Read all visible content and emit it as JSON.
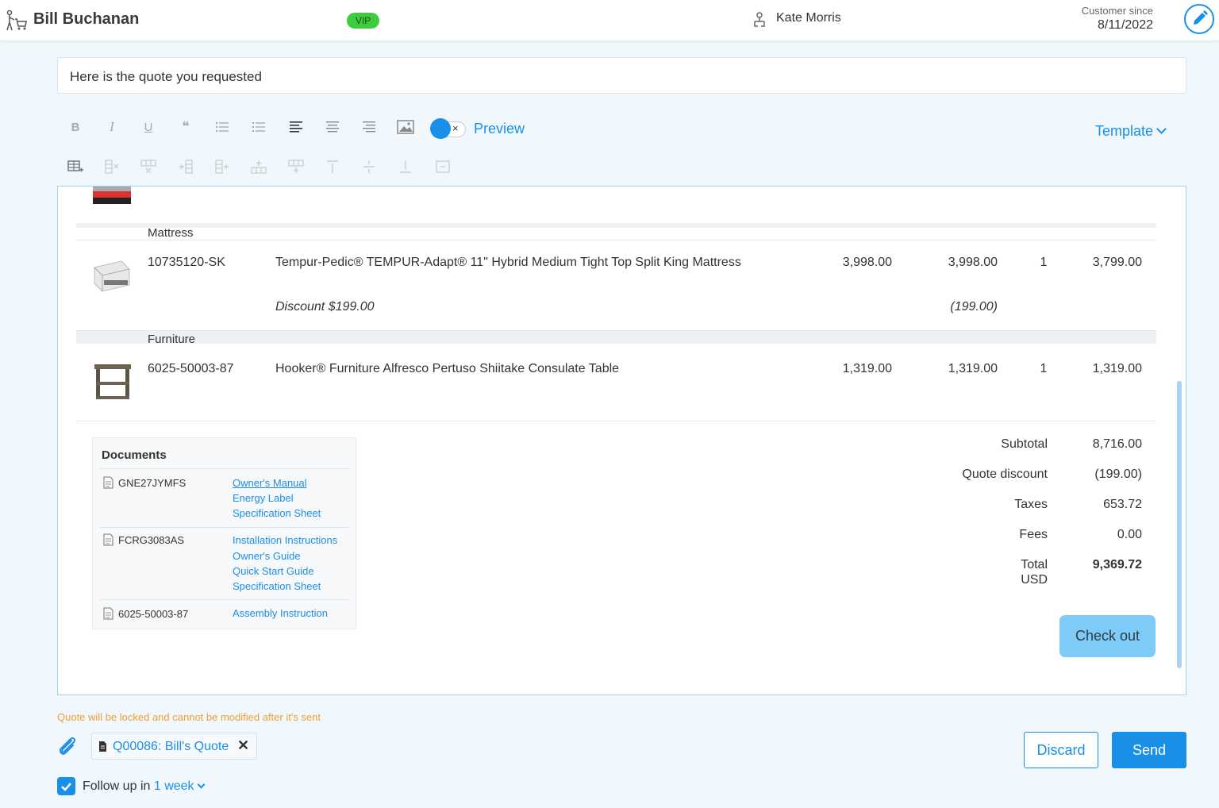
{
  "header": {
    "customer_name": "Bill Buchanan",
    "badge": "VIP",
    "agent_name": "Kate Morris",
    "customer_since_label": "Customer since",
    "customer_since_date": "8/11/2022"
  },
  "subject": "Here is the quote you requested",
  "toolbar": {
    "row1": [
      "bold-icon",
      "italic-icon",
      "underline-icon",
      "blockquote-icon",
      "bullet-list-icon",
      "numbered-list-icon",
      "align-left-icon",
      "align-center-icon",
      "align-right-icon",
      "image-icon"
    ],
    "row2": [
      "insert-table-icon",
      "delete-column-icon",
      "delete-row-icon",
      "insert-column-before-icon",
      "insert-column-after-icon",
      "insert-row-after-icon",
      "insert-row-before-icon",
      "align-top-icon",
      "align-middle-icon",
      "align-bottom-icon",
      "merge-cells-icon"
    ],
    "bold_glyph": "B",
    "italic_glyph": "I",
    "underline_glyph": "U",
    "quote_glyph": "❝",
    "preview_label": "Preview",
    "template_label": "Template",
    "toggle_close": "×"
  },
  "quote": {
    "groups": [
      {
        "category": "Mattress",
        "sku": "10735120-SK",
        "description": "Tempur-Pedic® TEMPUR-Adapt® 11\" Hybrid Medium Tight Top Split King Mattress",
        "list_price": "3,998.00",
        "price": "3,998.00",
        "qty": "1",
        "total": "3,799.00",
        "discount_label": "Discount $199.00",
        "discount_value": "(199.00)"
      },
      {
        "category": "Furniture",
        "sku": "6025-50003-87",
        "description": "Hooker® Furniture Alfresco Pertuso Shiitake Consulate Table",
        "list_price": "1,319.00",
        "price": "1,319.00",
        "qty": "1",
        "total": "1,319.00"
      }
    ],
    "documents": {
      "title": "Documents",
      "items": [
        {
          "id": "GNE27JYMFS",
          "links": [
            "Owner's Manual",
            "Energy Label",
            "Specification Sheet"
          ]
        },
        {
          "id": "FCRG3083AS",
          "links": [
            "Installation Instructions",
            "Owner's Guide",
            "Quick Start Guide",
            "Specification Sheet"
          ]
        },
        {
          "id": "6025-50003-87",
          "links": [
            "Assembly Instruction"
          ]
        }
      ]
    },
    "totals": {
      "subtotal_label": "Subtotal",
      "subtotal": "8,716.00",
      "discount_label": "Quote discount",
      "discount": "(199.00)",
      "taxes_label": "Taxes",
      "taxes": "653.72",
      "fees_label": "Fees",
      "fees": "0.00",
      "total_label": "Total",
      "currency": "USD",
      "total": "9,369.72"
    },
    "checkout_label": "Check out"
  },
  "footer": {
    "warning": "Quote will be locked and cannot be modified after it's sent",
    "attachment": "Q00086: Bill's Quote",
    "attachment_remove": "✕",
    "discard_label": "Discard",
    "send_label": "Send",
    "follow_up_label": "Follow up",
    "follow_up_in": "in",
    "follow_up_value": "1 week",
    "follow_up_checked": true
  },
  "colors": {
    "accent": "#1a8fe8",
    "vip": "#3dcc3d",
    "warning": "#f0a030",
    "checkout": "#7ecbf7"
  }
}
